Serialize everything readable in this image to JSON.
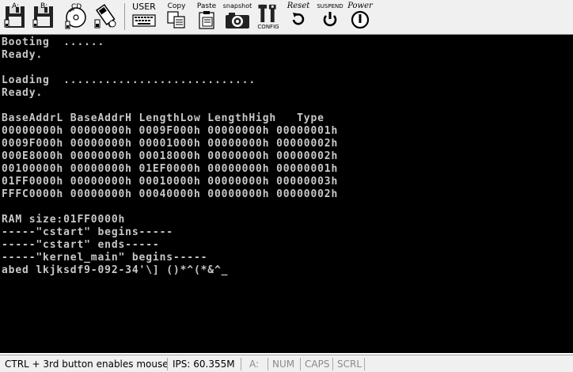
{
  "toolbar": {
    "floppy_a_label": "A:",
    "floppy_b_label": "B:",
    "cdrom_label": "CD",
    "user_label": "USER",
    "copy_label": "Copy",
    "paste_label": "Paste",
    "snapshot_label": "snapshot",
    "config_label": "CONFIG",
    "reset_label": "Reset",
    "suspend_label": "SUSPEND",
    "power_label": "Power"
  },
  "console": {
    "lines": [
      "Booting  ......",
      "Ready.",
      "",
      "Loading  ............................",
      "Ready.",
      "",
      "BaseAddrL BaseAddrH LengthLow LengthHigh   Type",
      "00000000h 00000000h 0009F000h 00000000h 00000001h",
      "0009F000h 00000000h 00001000h 00000000h 00000002h",
      "000E8000h 00000000h 00018000h 00000000h 00000002h",
      "00100000h 00000000h 01EF0000h 00000000h 00000001h",
      "01FF0000h 00000000h 00010000h 00000000h 00000003h",
      "FFFC0000h 00000000h 00040000h 00000000h 00000002h",
      "",
      "RAM size:01FF0000h",
      "-----\"cstart\" begins-----",
      "-----\"cstart\" ends-----",
      "-----\"kernel_main\" begins-----",
      "abed lkjksdf9-092-34'\\] ()*^(*&^_"
    ]
  },
  "statusbar": {
    "mouse_hint": "CTRL + 3rd button enables mouse",
    "ips": "IPS: 60.355M",
    "drive": "A:",
    "num": "NUM",
    "caps": "CAPS",
    "scrl": "SCRL"
  },
  "colors": {
    "console_bg": "#000000",
    "console_fg": "#c8c8c8",
    "toolbar_bg": "#f0f0f0"
  }
}
